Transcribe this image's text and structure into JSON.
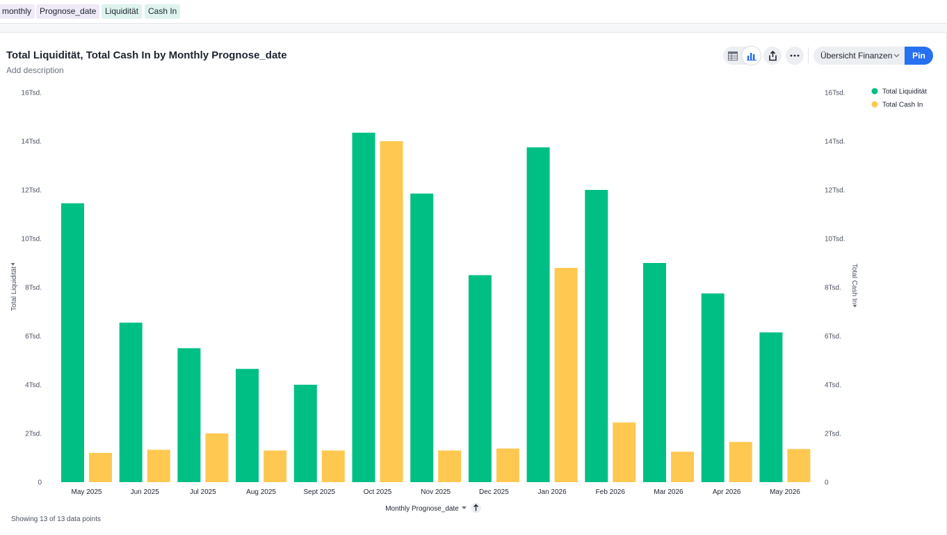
{
  "filters": [
    {
      "label": "monthly",
      "color": "#efeaf7"
    },
    {
      "label": "Prognose_date",
      "color": "#efeaf7"
    },
    {
      "label": "Liquidität",
      "color": "#dff3ee"
    },
    {
      "label": "Cash In",
      "color": "#dff3ee"
    }
  ],
  "header": {
    "title": "Total Liquidität, Total Cash In by Monthly Prognose_date",
    "description": "Add description"
  },
  "toolbar": {
    "table_icon": "table-icon",
    "chart_icon": "bar-chart-icon",
    "share_icon": "share-icon",
    "more_icon": "more-icon",
    "liveboard_label": "Übersicht Finanzen",
    "pin_label": "Pin"
  },
  "footer": {
    "data_points_text": "Showing 13 of 13 data points"
  },
  "colors": {
    "liquiditaet": "#00bf85",
    "cash_in": "#ffc851",
    "pin": "#2770ef"
  },
  "chart_data": {
    "type": "bar",
    "title": "Total Liquidität, Total Cash In by Monthly Prognose_date",
    "xlabel": "Monthly Prognose_date",
    "ylabel": "Total Liquidität",
    "y2label": "Total Cash In",
    "categories": [
      "May 2025",
      "Jun 2025",
      "Jul 2025",
      "Aug 2025",
      "Sept 2025",
      "Oct 2025",
      "Nov 2025",
      "Dec 2025",
      "Jan 2026",
      "Feb 2026",
      "Mar 2026",
      "Apr 2026",
      "May 2026"
    ],
    "series": [
      {
        "name": "Total Liquidität",
        "axis": "left",
        "color": "#00bf85",
        "values": [
          11450,
          6550,
          5500,
          4650,
          4000,
          14350,
          11850,
          8500,
          13750,
          12000,
          9000,
          7750,
          6150
        ]
      },
      {
        "name": "Total Cash In",
        "axis": "right",
        "color": "#ffc851",
        "values": [
          1200,
          1330,
          2000,
          1300,
          1300,
          14000,
          1300,
          1380,
          8800,
          2450,
          1250,
          1650,
          1360
        ]
      }
    ],
    "ylim": [
      0,
      16000
    ],
    "y2lim": [
      0,
      16000
    ],
    "yticks": [
      "0",
      "2Tsd.",
      "4Tsd.",
      "6Tsd.",
      "8Tsd.",
      "10Tsd.",
      "12Tsd.",
      "14Tsd.",
      "16Tsd."
    ],
    "y2ticks": [
      "0",
      "2Tsd.",
      "4Tsd.",
      "6Tsd.",
      "8Tsd.",
      "10Tsd.",
      "12Tsd.",
      "14Tsd.",
      "16Tsd."
    ],
    "legend_position": "top-right",
    "grid": false
  }
}
